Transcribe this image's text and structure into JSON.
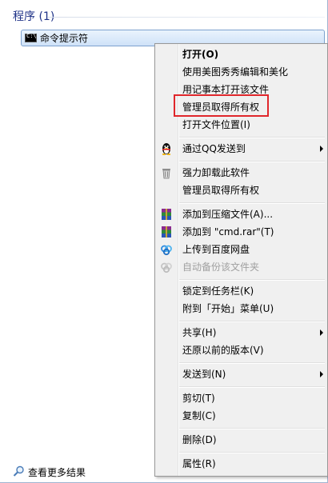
{
  "section": {
    "title": "程序 (1)"
  },
  "result": {
    "label": "命令提示符",
    "icon_text": "C:\\"
  },
  "menu": {
    "items": [
      {
        "label": "打开(O)"
      },
      {
        "label": "使用美图秀秀编辑和美化"
      },
      {
        "label": "用记事本打开该文件"
      },
      {
        "label": "管理员取得所有权"
      },
      {
        "label": "打开文件位置(I)"
      },
      {
        "label": "通过QQ发送到"
      },
      {
        "label": "强力卸载此软件"
      },
      {
        "label": "管理员取得所有权"
      },
      {
        "label": "添加到压缩文件(A)..."
      },
      {
        "label": "添加到 \"cmd.rar\"(T)"
      },
      {
        "label": "上传到百度网盘"
      },
      {
        "label": "自动备份该文件夹"
      },
      {
        "label": "锁定到任务栏(K)"
      },
      {
        "label": "附到「开始」菜单(U)"
      },
      {
        "label": "共享(H)"
      },
      {
        "label": "还原以前的版本(V)"
      },
      {
        "label": "发送到(N)"
      },
      {
        "label": "剪切(T)"
      },
      {
        "label": "复制(C)"
      },
      {
        "label": "删除(D)"
      },
      {
        "label": "属性(R)"
      }
    ]
  },
  "footer": {
    "label": "查看更多结果"
  },
  "colors": {
    "highlight": "#e0262b",
    "section_title": "#1e3287"
  }
}
